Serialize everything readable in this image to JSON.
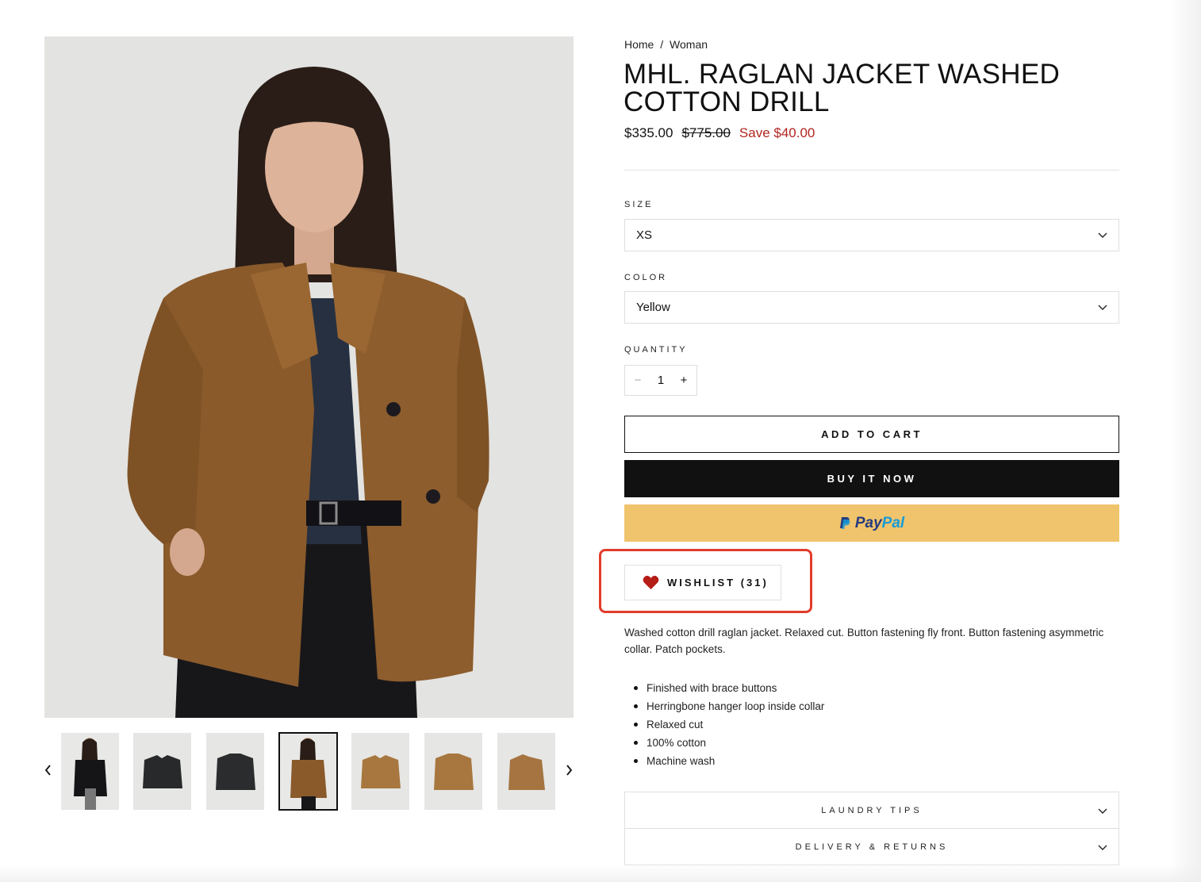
{
  "breadcrumb": {
    "home": "Home",
    "separator": "/",
    "current": "Woman"
  },
  "product": {
    "title": "MHL. RAGLAN JACKET WASHED COTTON DRILL",
    "price_now": "$335.00",
    "price_was": "$775.00",
    "price_save": "Save $40.00"
  },
  "options": {
    "size_label": "SIZE",
    "size_value": "XS",
    "color_label": "COLOR",
    "color_value": "Yellow",
    "quantity_label": "QUANTITY",
    "quantity_value": "1",
    "minus": "−",
    "plus": "+"
  },
  "buttons": {
    "add_to_cart": "ADD TO CART",
    "buy_now": "BUY IT NOW",
    "paypal_pay": "Pay",
    "paypal_pal": "Pal",
    "wishlist": "WISHLIST (31)"
  },
  "description": {
    "text": "Washed cotton drill raglan jacket. Relaxed cut. Button fastening fly front. Button fastening asymmetric collar. Patch pockets.",
    "bullets": [
      "Finished with brace buttons",
      "Herringbone hanger loop inside collar",
      "Relaxed cut",
      "100% cotton",
      "Machine wash"
    ]
  },
  "accordions": {
    "laundry": "LAUNDRY TIPS",
    "delivery": "DELIVERY & RETURNS"
  },
  "thumbnails": [
    {
      "icon": "model-black-jacket-thumbnail"
    },
    {
      "icon": "black-jacket-front-thumbnail"
    },
    {
      "icon": "black-jacket-back-thumbnail"
    },
    {
      "icon": "model-brown-jacket-thumbnail",
      "active": true
    },
    {
      "icon": "brown-jacket-front-thumbnail"
    },
    {
      "icon": "brown-jacket-back-thumbnail"
    },
    {
      "icon": "brown-jacket-side-thumbnail"
    }
  ],
  "colors": {
    "sale_red": "#b1261f",
    "paypal_yellow": "#f0c46c",
    "highlight_red": "#e13c2b",
    "jacket_brown": "#8a5a2b"
  }
}
